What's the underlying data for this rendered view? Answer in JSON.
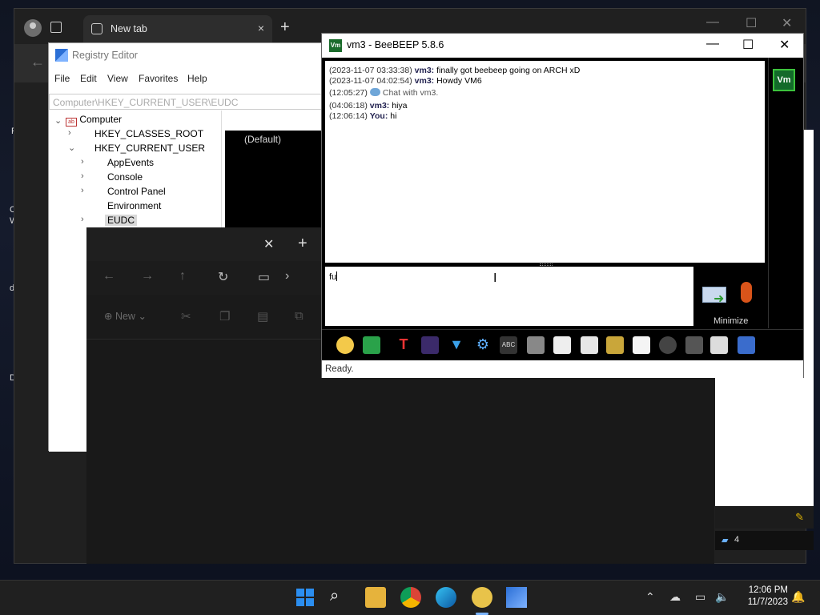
{
  "browser": {
    "tab_label": "New tab",
    "tab_close": "×",
    "new_tab": "+",
    "minimize": "—",
    "maximize": "☐",
    "close": "✕",
    "back": "←"
  },
  "desktop": {
    "labels": [
      "F",
      "C",
      "W",
      "d",
      "D"
    ]
  },
  "regedit": {
    "title": "Registry Editor",
    "menu": [
      "File",
      "Edit",
      "View",
      "Favorites",
      "Help"
    ],
    "address": "Computer\\HKEY_CURRENT_USER\\EUDC",
    "tree": {
      "root": "Computer",
      "hkcr": "HKEY_CLASSES_ROOT",
      "hkcu": "HKEY_CURRENT_USER",
      "children": [
        "AppEvents",
        "Console",
        "Control Panel",
        "Environment",
        "EUDC"
      ]
    },
    "default_value": "(Default)"
  },
  "explorer": {
    "tab_close": "✕",
    "new_tab": "+",
    "new_button": "New"
  },
  "beebeep": {
    "title": "vm3 - BeeBEEP 5.8.6",
    "messages": [
      {
        "ts": "(2023-11-07 03:33:38)",
        "who": "vm3:",
        "text": "finally got beebeep going on ARCH xD"
      },
      {
        "ts": "(2023-11-07 04:02:54)",
        "who": "vm3:",
        "text": "Howdy VM6"
      },
      {
        "ts": "(12:05:27)",
        "who": "",
        "text": "Chat with vm3."
      },
      {
        "ts": "(04:06:18)",
        "who": "vm3:",
        "text": "hiya"
      },
      {
        "ts": "(12:06:14)",
        "who": "You:",
        "text": "hi"
      }
    ],
    "input_value": "fu",
    "minimize_label": "Minimize",
    "user_badge": "Vm",
    "status": "Ready."
  },
  "taskbar": {
    "time": "12:06 PM",
    "date": "11/7/2023"
  },
  "sidepanel": {
    "count": "4"
  }
}
